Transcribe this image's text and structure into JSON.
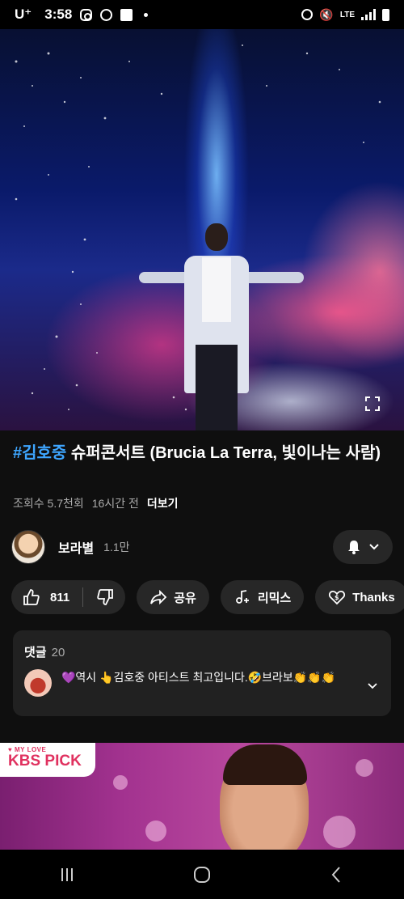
{
  "status_bar": {
    "carrier": "U⁺",
    "time": "3:58",
    "network": "LTE"
  },
  "video": {
    "fullscreen_icon": "fullscreen-icon"
  },
  "title": {
    "hashtag": "#김호중",
    "text": " 슈퍼콘서트 (Brucia La Terra, 빛이나는 사람)"
  },
  "meta": {
    "views": "조회수 5.7천회",
    "age": "16시간 전",
    "more": "더보기"
  },
  "channel": {
    "name": "보라별",
    "subscribers": "1.1만"
  },
  "actions": {
    "likes": "811",
    "share": "공유",
    "remix": "리믹스",
    "thanks": "Thanks"
  },
  "comments": {
    "header": "댓글",
    "count": "20",
    "top_comment": "💜역시 👆김호중 아티스트 최고입니다.🤣브라보👏👏👏"
  },
  "recommended": {
    "badge_small": "MY LOVE",
    "badge_main": "KBS PICK"
  },
  "colors": {
    "background": "#0f0f0f",
    "pill": "#272727",
    "hashtag": "#3ea6ff",
    "kbs": "#e0315f"
  }
}
